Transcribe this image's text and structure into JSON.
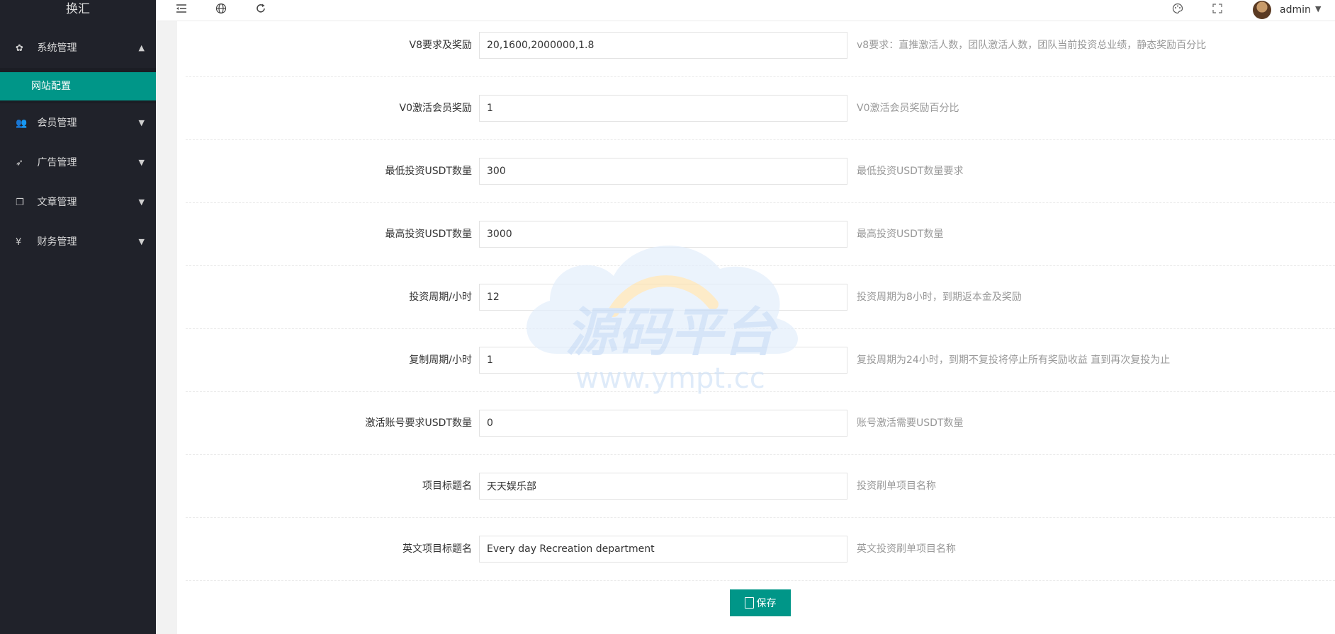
{
  "app": {
    "logo": "换汇"
  },
  "sidebar": {
    "items": [
      {
        "label": "系统管理",
        "icon": "gear-icon",
        "expanded": true,
        "children": [
          {
            "label": "网站配置",
            "active": true
          }
        ]
      },
      {
        "label": "会员管理",
        "icon": "users-icon"
      },
      {
        "label": "广告管理",
        "icon": "rocket-icon"
      },
      {
        "label": "文章管理",
        "icon": "copy-icon"
      },
      {
        "label": "财务管理",
        "icon": "yen-icon"
      }
    ]
  },
  "header": {
    "icons": [
      "menu-fold-icon",
      "globe-icon",
      "refresh-icon",
      "theme-icon",
      "fullscreen-icon"
    ],
    "user": "admin"
  },
  "form": {
    "rows": [
      {
        "label": "V8要求及奖励",
        "value": "20,1600,2000000,1.8",
        "tip": "v8要求：直推激活人数，团队激活人数，团队当前投资总业绩，静态奖励百分比"
      },
      {
        "label": "V0激活会员奖励",
        "value": "1",
        "tip": "V0激活会员奖励百分比"
      },
      {
        "label": "最低投资USDT数量",
        "value": "300",
        "tip": "最低投资USDT数量要求"
      },
      {
        "label": "最高投资USDT数量",
        "value": "3000",
        "tip": "最高投资USDT数量"
      },
      {
        "label": "投资周期/小时",
        "value": "12",
        "tip": "投资周期为8小时，到期返本金及奖励"
      },
      {
        "label": "复制周期/小时",
        "value": "1",
        "tip": "复投周期为24小时，到期不复投将停止所有奖励收益 直到再次复投为止"
      },
      {
        "label": "激活账号要求USDT数量",
        "value": "0",
        "tip": "账号激活需要USDT数量"
      },
      {
        "label": "项目标题名",
        "value": "天天娱乐部",
        "tip": "投资刷单项目名称"
      },
      {
        "label": "英文项目标题名",
        "value": "Every day Recreation department",
        "tip": "英文投资刷单项目名称"
      }
    ],
    "save_label": "保存"
  },
  "watermark": {
    "text": "源码平台",
    "url": "www.ympt.cc"
  },
  "colors": {
    "sidebar_bg": "#20222a",
    "accent": "#009688"
  }
}
